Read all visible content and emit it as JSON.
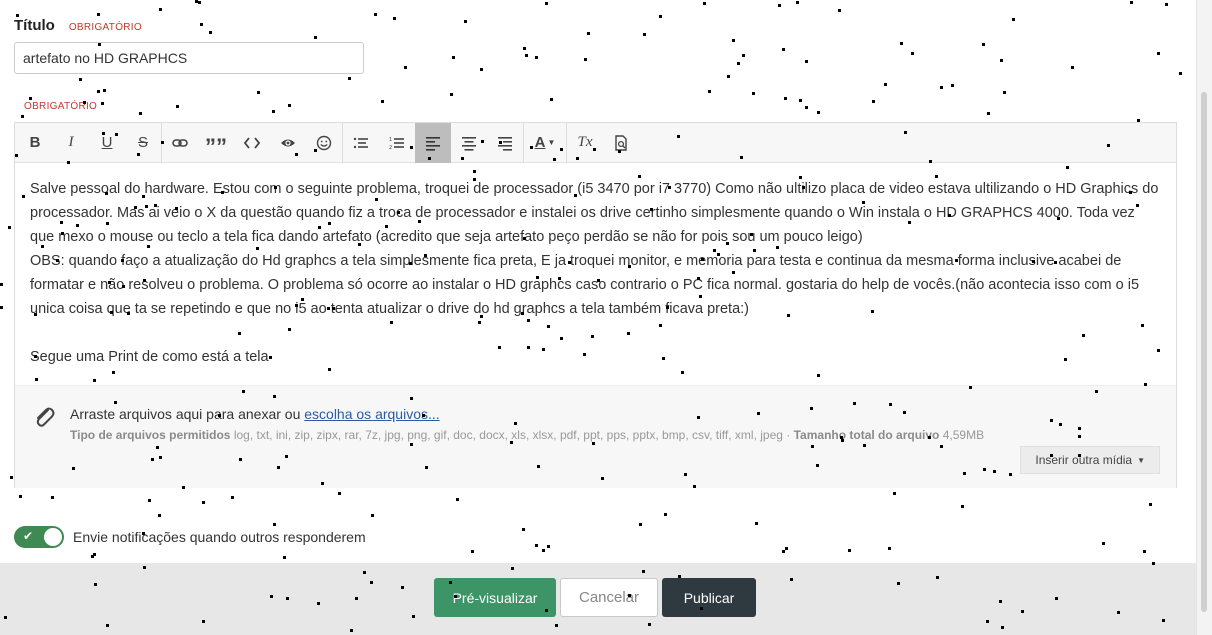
{
  "form": {
    "title_label": "Título",
    "required_label": "OBRIGATÓRIO",
    "title_value": "artefato no HD GRAPHCS",
    "body_required_label": "OBRIGATÓRIO"
  },
  "toolbar": {
    "bold": "B",
    "italic": "I",
    "underline": "U",
    "strike": "S",
    "quote": "””",
    "text_color": "A",
    "clear_format": "Tx"
  },
  "body": {
    "paragraph_1": "Salve pessoal do hardware. Estou com o seguinte problema, troquei de processador (i5 3470 por i7 3770) Como não ultilizo placa de video estava ultilizando o HD Graphics do processador. Mas ai veio o X da questão quando fiz a troca de processador e instalei os drive certinho simplesmente quando o Win instala o HD GRAPHCS 4000. Toda vez que mexo o mouse ou teclo a tela fica dando artefato (acredito que seja artefato peço perdão se não for pois sou um pouco leigo)",
    "paragraph_2": "OBS: quando faço a atualização do Hd graphcs a tela simplesmente fica preta, E ja troquei monitor, e memoria para testa e continua da mesma forma inclusive acabei de formatar e não resolveu o problema. O problema só ocorre ao instalar o HD graphcs caso contrario o PC fica normal.   gostaria do help de vocês.(não acontecia isso com o i5 unica coisa que ta se repetindo e que no i5 ao tenta atualizar o drive do hd graphcs a tela também ficava preta:)",
    "paragraph_3": "Segue uma Print de como está a tela"
  },
  "attachments": {
    "drop_text": "Arraste arquivos aqui para anexar ou ",
    "choose_link": "escolha os arquivos...",
    "types_label": "Tipo de arquivos permitidos",
    "types_list": " log, txt, ini, zip, zipx, rar, 7z, jpg, png, gif, doc, docx, xls, xlsx, pdf, ppt, pps, pptx, bmp, csv, tiff, xml, jpeg · ",
    "size_label": "Tamanho total do arquivo",
    "size_value": " 4,59MB",
    "insert_media": "Inserir outra mídia"
  },
  "notifications": {
    "label": "Envie notificações quando outros responderem",
    "enabled": true
  },
  "footer": {
    "preview": "Pré-visualizar",
    "cancel": "Cancelar",
    "publish": "Publicar"
  },
  "colors": {
    "accent_green": "#3d9467",
    "publish_dark": "#2f3a40",
    "required_red": "#c0392b",
    "link_blue": "#2a5aa8"
  }
}
